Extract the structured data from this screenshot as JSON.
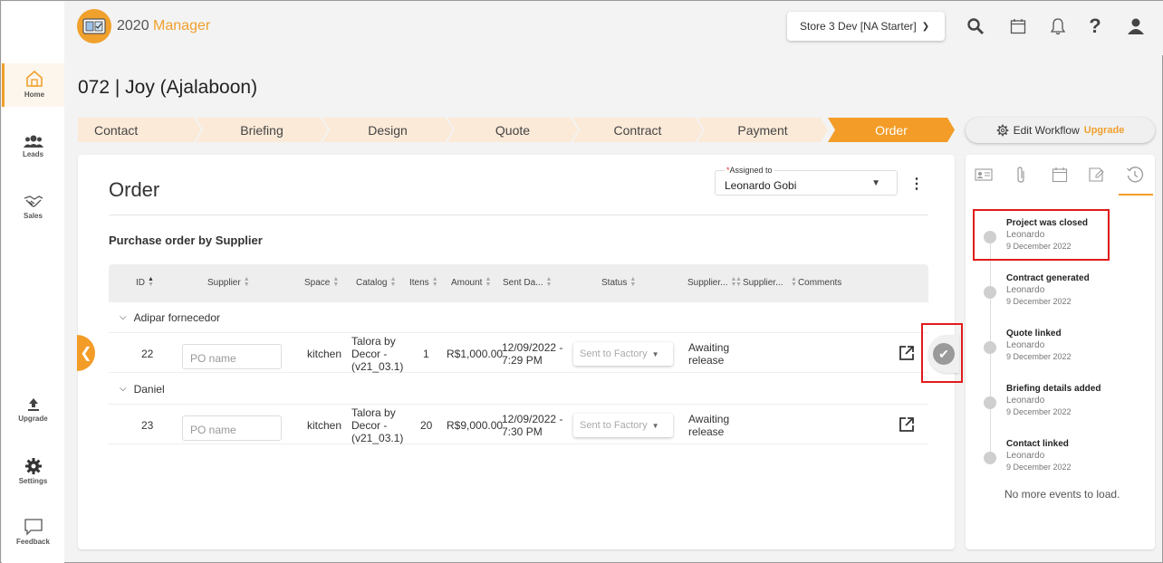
{
  "app": {
    "brand_prefix": "2020",
    "brand_suffix": "Manager",
    "store": "Store 3 Dev [NA Starter]"
  },
  "nav": {
    "home": "Home",
    "leads": "Leads",
    "sales": "Sales",
    "upgrade": "Upgrade",
    "settings": "Settings",
    "feedback": "Feedback"
  },
  "page": {
    "title": "072 | Joy (Ajalaboon)"
  },
  "steps": [
    "Contact",
    "Briefing",
    "Design",
    "Quote",
    "Contract",
    "Payment",
    "Order"
  ],
  "edit_workflow": {
    "label": "Edit Workflow",
    "upgrade": "Upgrade"
  },
  "order": {
    "title": "Order",
    "assigned_label": "Assigned to",
    "assigned_required": "*",
    "assigned_value": "Leonardo Gobi",
    "section": "Purchase order by Supplier",
    "columns": [
      "ID",
      "Supplier",
      "Space",
      "Catalog",
      "Itens",
      "Amount",
      "Sent Da...",
      "Status",
      "Supplier...",
      "Supplier...",
      "Comments"
    ],
    "groups": [
      {
        "name": "Adipar fornecedor",
        "rows": [
          {
            "id": "22",
            "po_placeholder": "PO name",
            "space": "kitchen",
            "catalog": "Talora by Decor - (v21_03.1)",
            "items": "1",
            "amount": "R$1,000.00",
            "sent_date": "12/09/2022 - 7:29 PM",
            "status": "Sent to Factory",
            "supplier_status": "Awaiting release"
          }
        ]
      },
      {
        "name": "Daniel",
        "rows": [
          {
            "id": "23",
            "po_placeholder": "PO name",
            "space": "kitchen",
            "catalog": "Talora by Decor - (v21_03.1)",
            "items": "20",
            "amount": "R$9,000.00",
            "sent_date": "12/09/2022 - 7:30 PM",
            "status": "Sent to Factory",
            "supplier_status": "Awaiting release"
          }
        ]
      }
    ]
  },
  "history": {
    "events": [
      {
        "title": "Project was closed",
        "user": "Leonardo",
        "date": "9 December 2022"
      },
      {
        "title": "Contract generated",
        "user": "Leonardo",
        "date": "9 December 2022"
      },
      {
        "title": "Quote linked",
        "user": "Leonardo",
        "date": "9 December 2022"
      },
      {
        "title": "Briefing details added",
        "user": "Leonardo",
        "date": "9 December 2022"
      },
      {
        "title": "Contact linked",
        "user": "Leonardo",
        "date": "9 December 2022"
      }
    ],
    "no_more": "No more events to load."
  },
  "colors": {
    "accent": "#f39c27",
    "step_bg": "#fbead8",
    "highlight": "#e01b1b"
  }
}
